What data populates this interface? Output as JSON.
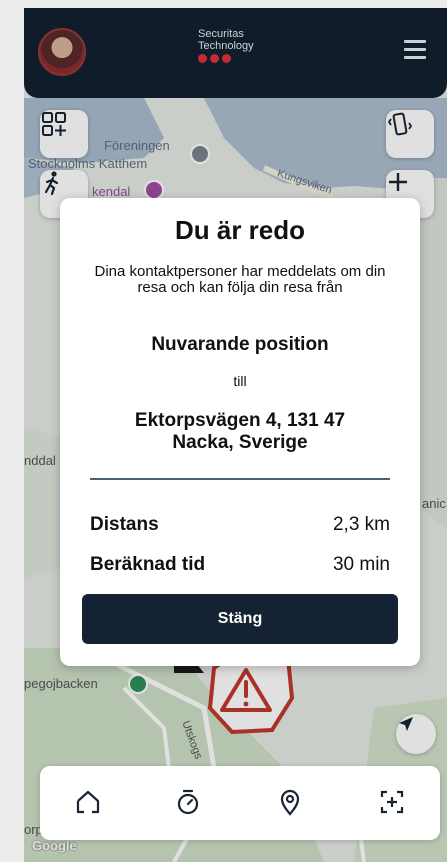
{
  "header": {
    "brand_line1": "Securitas",
    "brand_line2": "Technology",
    "brand_dot_color": "#e1313b",
    "menu_icon": "hamburger-menu-icon",
    "avatar_icon": "user-avatar"
  },
  "map": {
    "labels": {
      "foreningen": "Föreningen",
      "katthem": "Stocknolms Katthem",
      "kendal": "kendal",
      "kungsviken": "Kungsviken",
      "nddal": "nddal",
      "anic": "anic",
      "pegojbacken": "pegojbacken",
      "utskogs": "Utskogs",
      "orp": "orp",
      "google": "Google"
    },
    "left_button_icons": [
      "add-widget-icon",
      "person-walking-icon"
    ],
    "right_button_icons": [
      "vibrate-phone-icon",
      "zoom-in-icon"
    ],
    "compass_icon": "navigation-arrow-icon",
    "alert_icon": "warning-triangle-icon",
    "alert_color": "#c0392b"
  },
  "modal": {
    "title": "Du är redo",
    "message": "Dina kontaktpersoner har meddelats om din resa och kan följa din resa från",
    "origin": "Nuvarande position",
    "to_word": "till",
    "destination_line1": "Ektorpsvägen 4, 131 47",
    "destination_line2": "Nacka, Sverige",
    "distance_label": "Distans",
    "distance_value": "2,3 km",
    "eta_label": "Beräknad tid",
    "eta_value": "30 min",
    "close_button": "Stäng"
  },
  "bottom_nav": {
    "items": [
      {
        "icon": "home-icon"
      },
      {
        "icon": "timer-icon"
      },
      {
        "icon": "location-pin-icon"
      },
      {
        "icon": "scan-add-icon"
      }
    ]
  },
  "colors": {
    "header_bg": "#132030",
    "button_bg": "#152233",
    "divider": "#4a5f7a"
  }
}
